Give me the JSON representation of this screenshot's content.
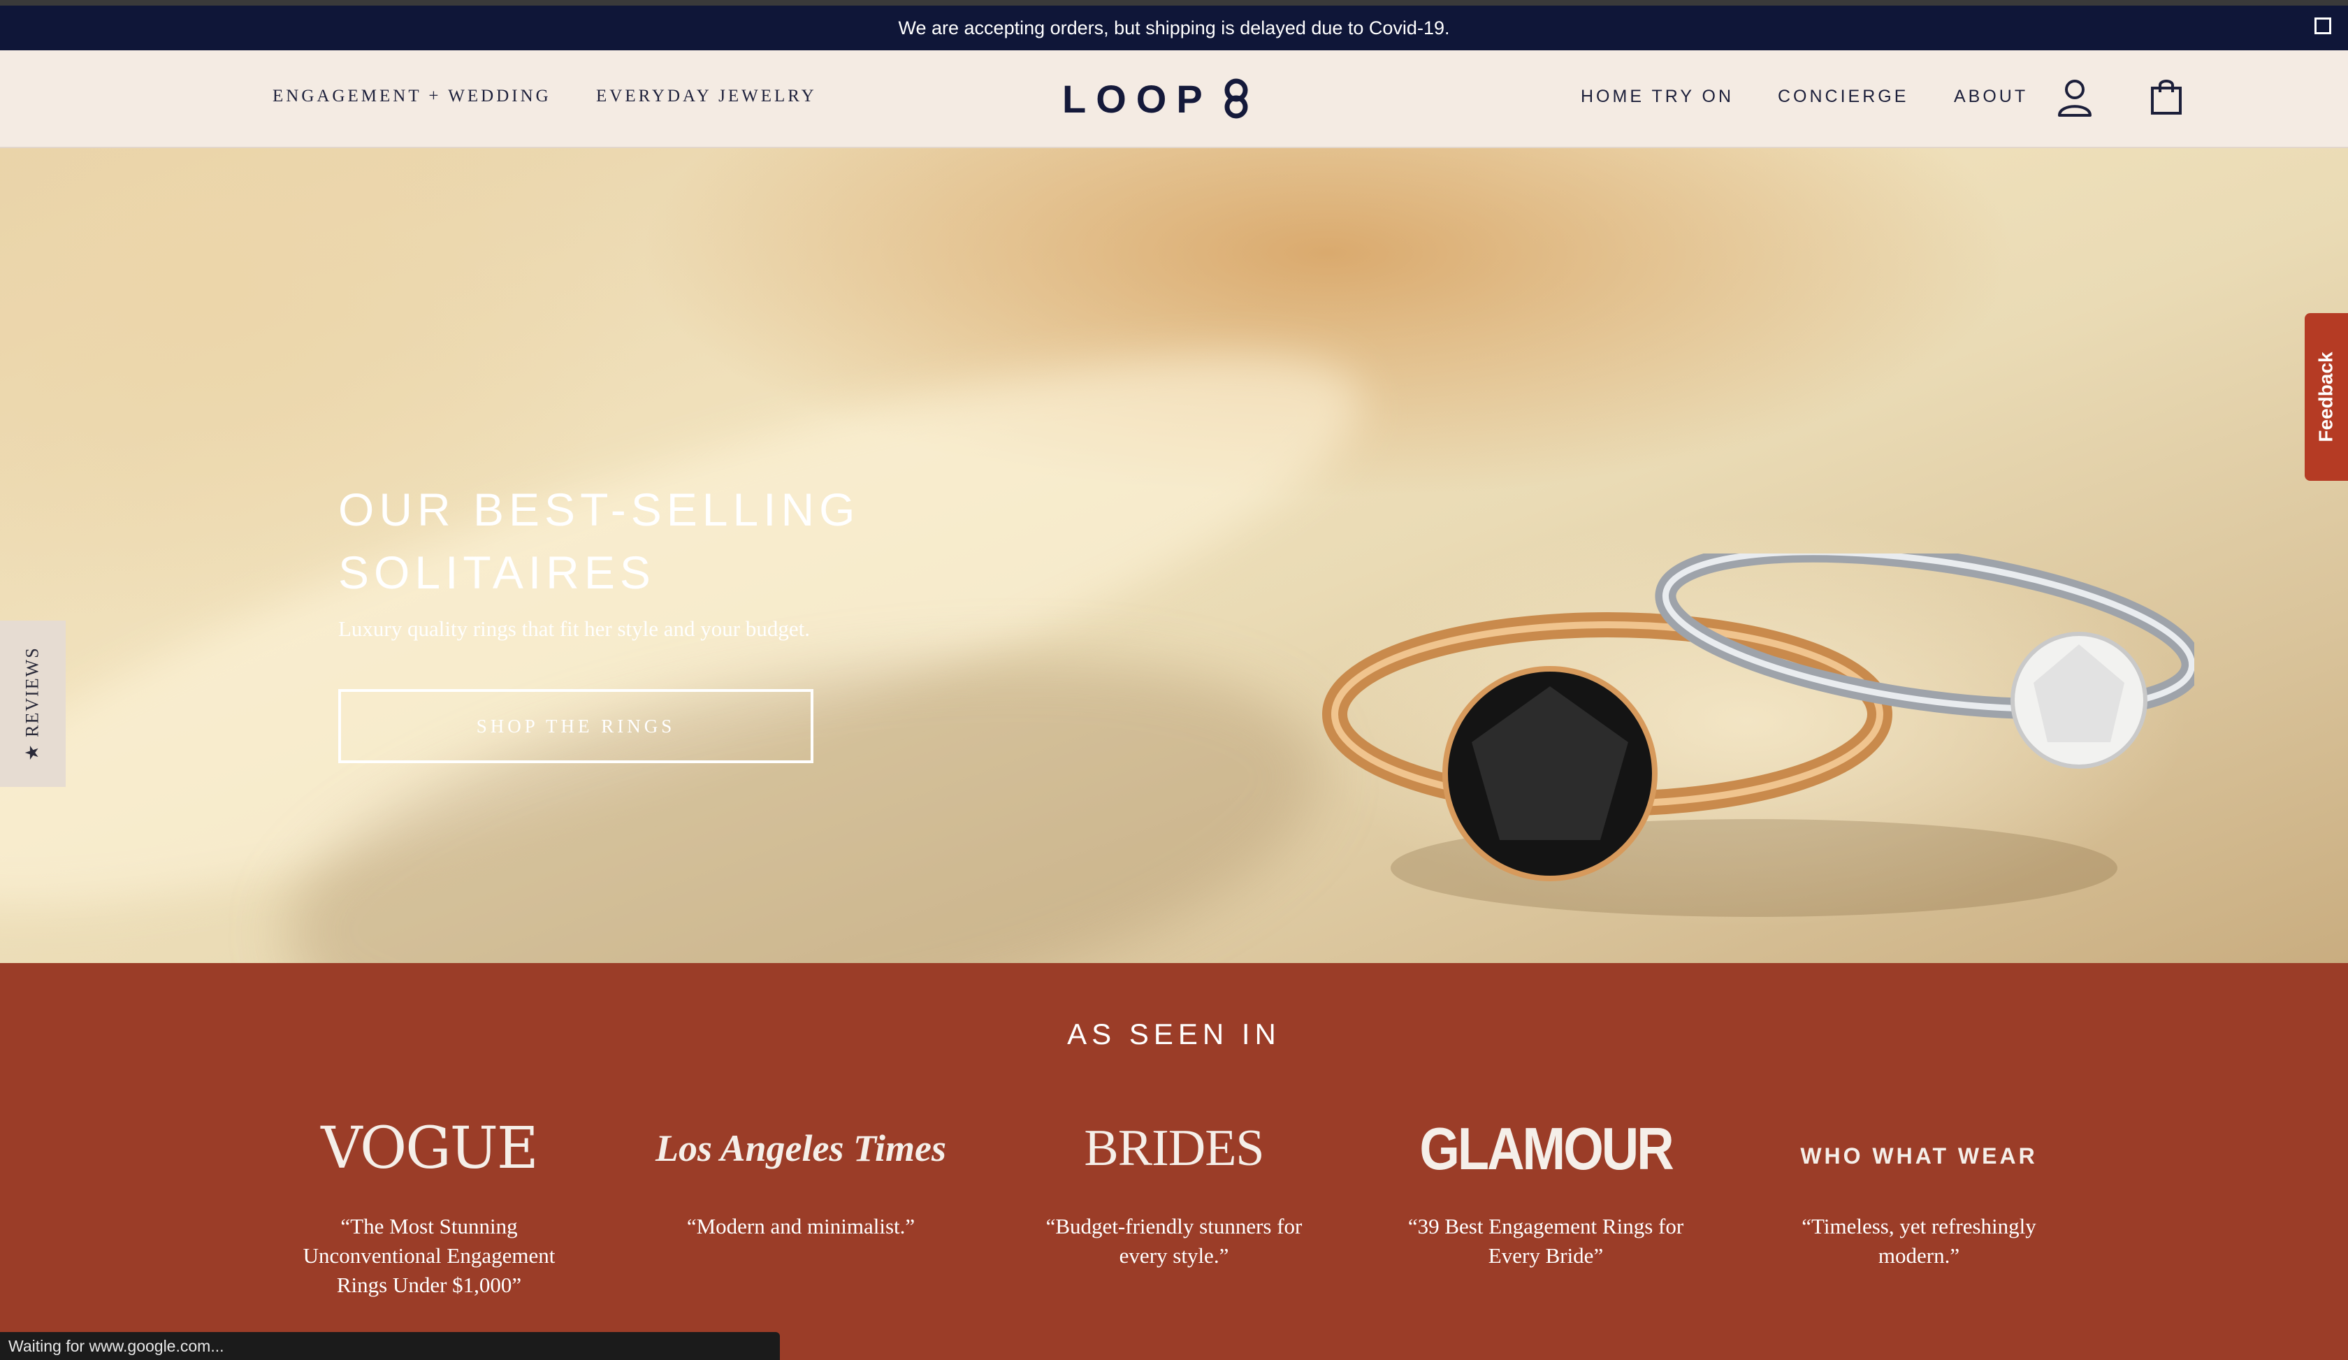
{
  "announcement": {
    "text": "We are accepting orders, but shipping is delayed due to Covid-19."
  },
  "nav": {
    "left": [
      "ENGAGEMENT + WEDDING",
      "EVERYDAY JEWELRY"
    ],
    "logo": "LOOP",
    "right": [
      "HOME TRY ON",
      "CONCIERGE",
      "ABOUT"
    ],
    "icons": [
      "account-icon",
      "shopping-bag-icon",
      "loop-logo-icon"
    ]
  },
  "hero": {
    "title_line1": "OUR BEST-SELLING",
    "title_line2": "SOLITAIRES",
    "subtitle": "Luxury quality rings that fit her style and your budget.",
    "button": "SHOP THE RINGS"
  },
  "side_tabs": {
    "reviews": "★ REVIEWS",
    "feedback": "Feedback"
  },
  "press": {
    "heading": "AS SEEN IN",
    "items": [
      {
        "logo": "VOGUE",
        "quote": "“The Most Stunning Unconventional Engagement Rings Under $1,000”"
      },
      {
        "logo": "Los Angeles Times",
        "quote": "“Modern and minimalist.”"
      },
      {
        "logo": "BRIDES",
        "quote": "“Budget-friendly stunners for every style.”"
      },
      {
        "logo": "GLAMOUR",
        "quote": "“39 Best Engagement Rings for Every Bride”"
      },
      {
        "logo": "WHO WHAT WEAR",
        "quote": "“Timeless, yet refreshingly modern.”"
      }
    ]
  },
  "status": {
    "text": "Waiting for www.google.com..."
  },
  "colors": {
    "navy": "#0f1638",
    "nav_bg": "#f4ebe3",
    "press_bg": "#9b3d28",
    "feedback": "#b53b24"
  }
}
